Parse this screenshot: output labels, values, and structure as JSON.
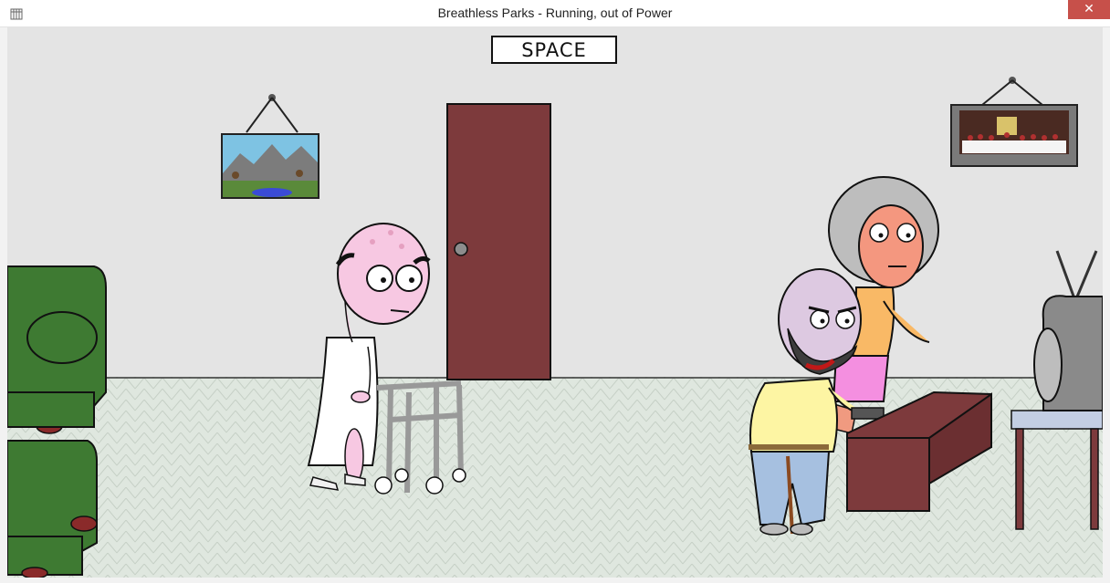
{
  "window": {
    "title": "Breathless Parks - Running, out of Power",
    "close_glyph": "✕",
    "icon": "app-icon"
  },
  "scene": {
    "sign_text": "SPACE",
    "colors": {
      "wall": "#e4e4e4",
      "floor": "#dfe7df",
      "door": "#7d3a3c",
      "armchair": "#3e7a32",
      "table": "#7d3a3c",
      "tv": "#8a8a8a"
    }
  }
}
